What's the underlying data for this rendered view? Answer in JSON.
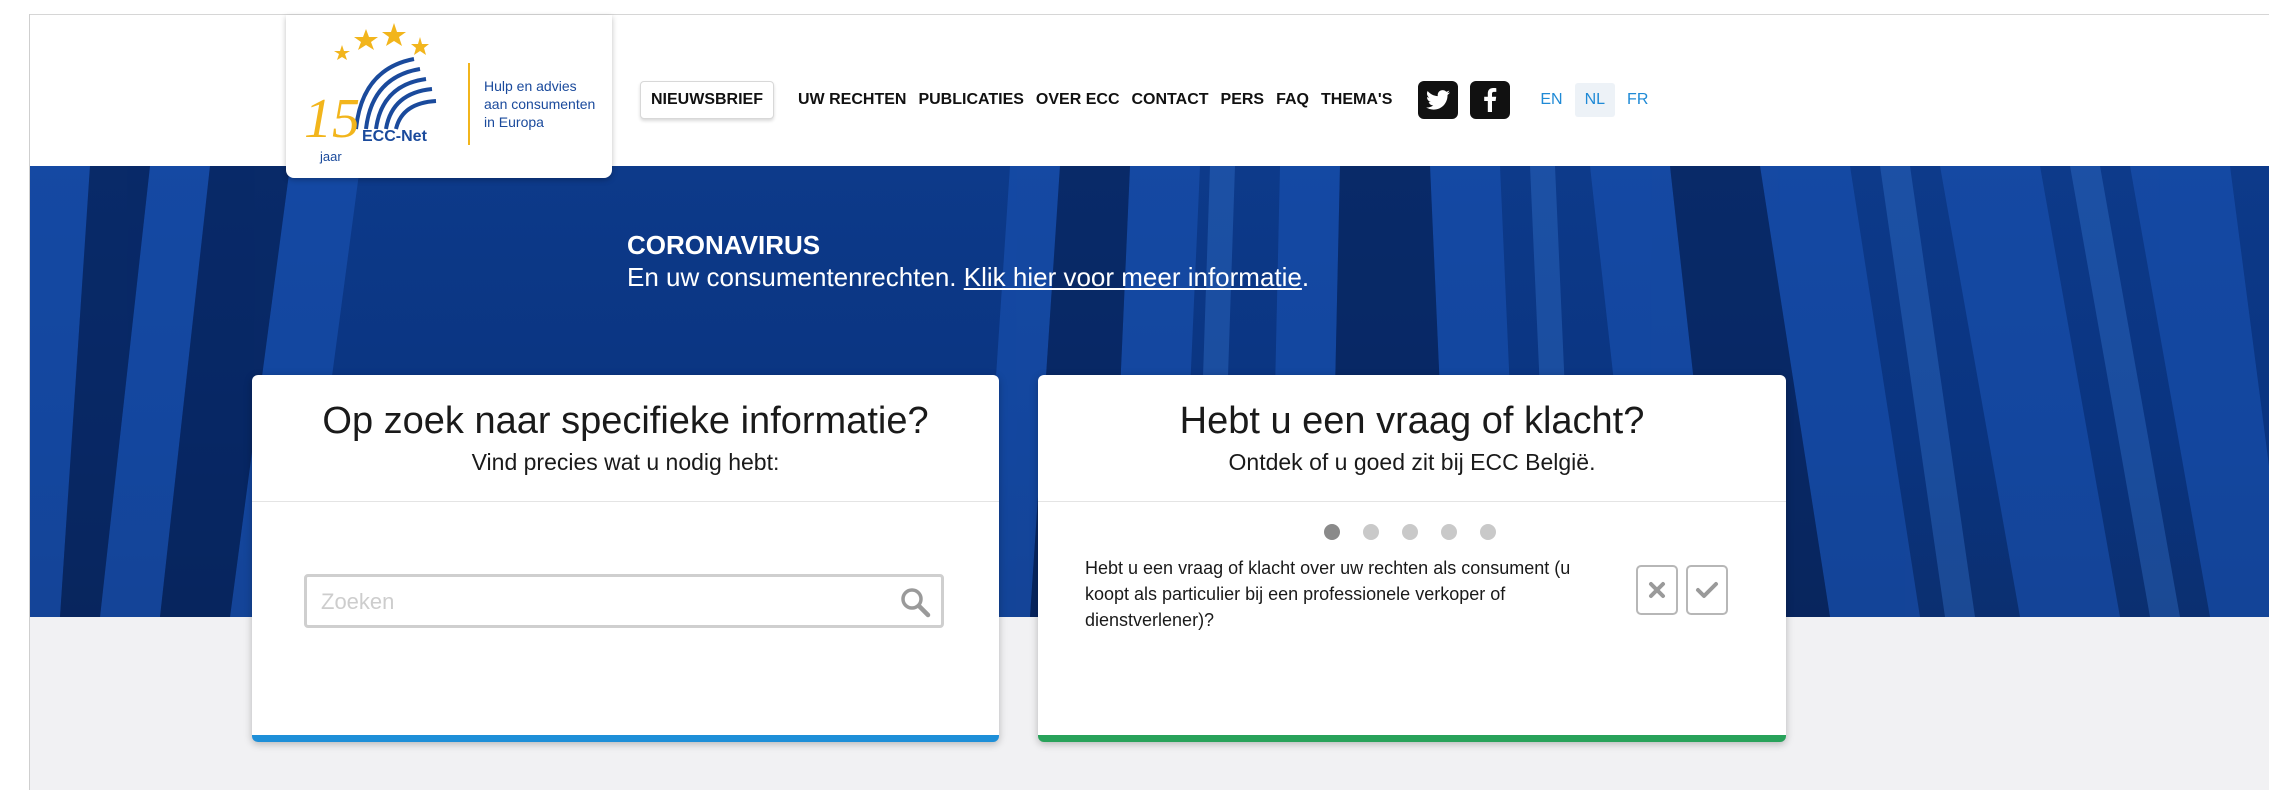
{
  "logo": {
    "number": "15",
    "jaar": "jaar",
    "network": "ECC-Net",
    "tagline": [
      "Hulp en advies",
      "aan consumenten",
      "in Europa"
    ]
  },
  "nav": {
    "newsletter": "NIEUWSBRIEF",
    "links": [
      "UW RECHTEN",
      "PUBLICATIES",
      "OVER ECC",
      "CONTACT",
      "PERS",
      "FAQ",
      "THEMA'S"
    ],
    "social": [
      {
        "name": "twitter-icon",
        "glyph": "🐦"
      },
      {
        "name": "facebook-icon",
        "glyph": "f"
      }
    ],
    "languages": [
      "EN",
      "NL",
      "FR"
    ],
    "active_language": "NL"
  },
  "hero": {
    "title": "CORONAVIRUS",
    "line_prefix": "En uw consumentenrechten. ",
    "link_text": "Klik hier voor meer informatie",
    "line_suffix": "."
  },
  "search_card": {
    "title": "Op zoek naar specifieke informatie?",
    "subtitle": "Vind precies wat u nodig hebt:",
    "placeholder": "Zoeken",
    "accent": "#1e8fd8"
  },
  "complaint_card": {
    "title": "Hebt u een vraag of klacht?",
    "subtitle": "Ontdek of u goed zit bij ECC België.",
    "steps": 5,
    "active_step": 1,
    "question": "Hebt u een vraag of klacht over uw rechten als consument (u koopt als particulier bij een professionele verkoper of dienstverlener)?",
    "accent": "#28a25a"
  },
  "colors": {
    "hero_blue": "#0d3a8a",
    "link_blue": "#1f8ad6",
    "logo_yellow": "#f2b51c"
  }
}
